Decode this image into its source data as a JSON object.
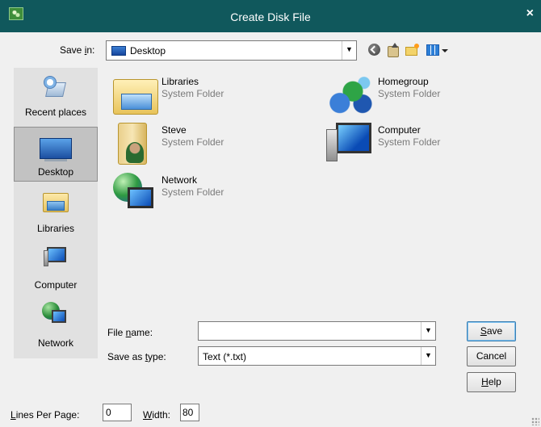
{
  "window": {
    "title": "Create Disk File",
    "close_glyph": "×"
  },
  "save_in": {
    "label_pre": "Save ",
    "label_accel": "i",
    "label_post": "n:",
    "value": "Desktop"
  },
  "toolbar": {
    "icons": [
      "back-icon",
      "up-folder-icon",
      "new-folder-icon",
      "view-menu-icon"
    ]
  },
  "places": [
    {
      "label": "Recent places",
      "icon": "recent-places-icon",
      "selected": false
    },
    {
      "label": "Desktop",
      "icon": "desktop-icon",
      "selected": true
    },
    {
      "label": "Libraries",
      "icon": "libraries-icon",
      "selected": false
    },
    {
      "label": "Computer",
      "icon": "computer-icon",
      "selected": false
    },
    {
      "label": "Network",
      "icon": "network-icon",
      "selected": false
    }
  ],
  "files": [
    {
      "name": "Libraries",
      "type": "System Folder",
      "icon": "libraries-icon"
    },
    {
      "name": "Homegroup",
      "type": "System Folder",
      "icon": "homegroup-icon"
    },
    {
      "name": "Steve",
      "type": "System Folder",
      "icon": "user-folder-icon"
    },
    {
      "name": "Computer",
      "type": "System Folder",
      "icon": "computer-icon"
    },
    {
      "name": "Network",
      "type": "System Folder",
      "icon": "network-icon"
    }
  ],
  "file_name": {
    "label_pre": "File ",
    "label_accel": "n",
    "label_post": "ame:",
    "value": "",
    "placeholder": ""
  },
  "save_as_type": {
    "label_pre": "Save as ",
    "label_accel": "t",
    "label_post": "ype:",
    "value": "Text (*.txt)"
  },
  "buttons": {
    "save": {
      "accel": "S",
      "rest": "ave"
    },
    "cancel": {
      "label": "Cancel"
    },
    "help": {
      "accel": "H",
      "rest": "elp"
    }
  },
  "footer": {
    "lines_per_page": {
      "accel": "L",
      "rest": "ines Per Page:",
      "value": "0"
    },
    "width": {
      "accel": "W",
      "rest": "idth:",
      "value": "80"
    }
  },
  "colors": {
    "titlebar": "#10585c",
    "places_bg": "#e1e1e1",
    "secondary_text": "#7a7a7a"
  }
}
